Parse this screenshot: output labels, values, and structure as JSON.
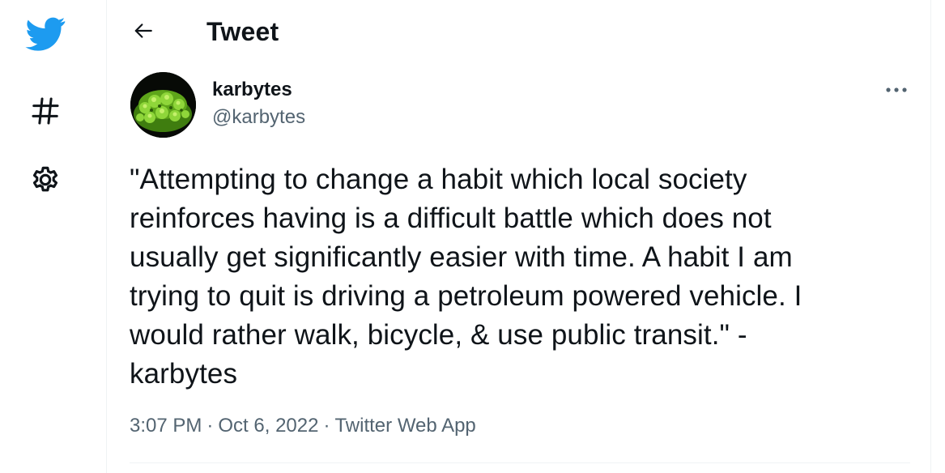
{
  "nav": {
    "items": [
      {
        "icon": "twitter-bird-icon",
        "color": "#1d9bf0"
      },
      {
        "icon": "hashtag-icon"
      },
      {
        "icon": "gear-icon"
      }
    ]
  },
  "header": {
    "back_icon": "arrow-left-icon",
    "title": "Tweet"
  },
  "tweet": {
    "author": {
      "display_name": "karbytes",
      "handle": "@karbytes",
      "avatar_icon": "romanesco-broccoli-avatar"
    },
    "more_icon": "ellipsis-icon",
    "text": "\"Attempting to change a habit which local society\nreinforces having is a difficult battle which does not\nusually get significantly easier with time. A habit I am\ntrying to quit is driving a petroleum powered vehicle. I\nwould rather walk, bicycle, & use public transit.\" -\nkarbytes",
    "time": "3:07 PM",
    "separator": "·",
    "date": "Oct 6, 2022",
    "source": "Twitter Web App"
  },
  "colors": {
    "brand": "#1d9bf0",
    "text_primary": "#0f1419",
    "text_secondary": "#536471",
    "border": "#eff3f4"
  }
}
